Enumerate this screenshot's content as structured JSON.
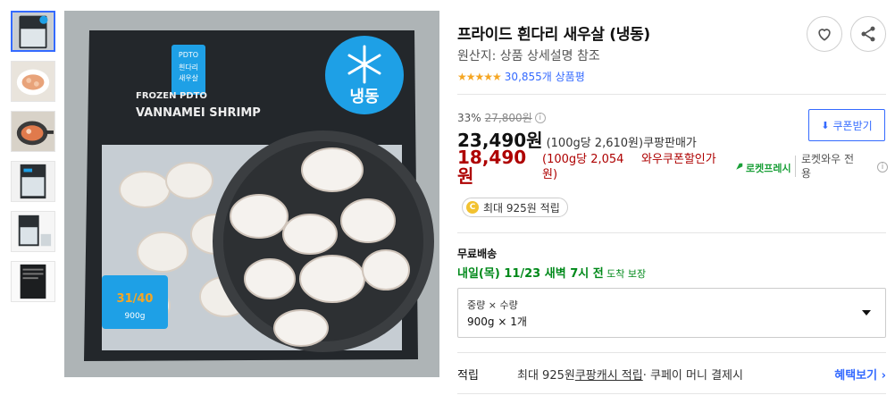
{
  "gallery": {
    "thumbnails": [
      {
        "name": "thumb-package-front",
        "active": true
      },
      {
        "name": "thumb-cooked-dish",
        "active": false
      },
      {
        "name": "thumb-pan-dish",
        "active": false
      },
      {
        "name": "thumb-package-detail",
        "active": false
      },
      {
        "name": "thumb-package-side",
        "active": false
      },
      {
        "name": "thumb-package-back",
        "active": false
      }
    ],
    "main_image": {
      "package_brand": "PDTO",
      "package_korean": "흰다리\n새우살",
      "package_line1": "FROZEN PDTO",
      "package_line2": "VANNAMEI SHRIMP",
      "frozen_badge": "냉동",
      "size_label": "31/40",
      "weight_label": "900g"
    }
  },
  "product": {
    "title": "프라이드 흰다리 새우살 (냉동)",
    "origin": "원산지: 상품 상세설명 참조",
    "stars": "★★★★★",
    "rating": 5,
    "review_count": "30,855개 상품평"
  },
  "pricing": {
    "discount_rate": "33%",
    "original_price": "27,800원",
    "info_mark": "i",
    "sale_price": "23,490원",
    "sale_unit": "(100g당 2,610원)",
    "sale_type": "쿠팡판매가",
    "wow_price": "18,490원",
    "wow_unit": "(100g당 2,054원)",
    "wow_label": "와우쿠폰할인가",
    "rocket_badge": "로켓프레시",
    "rocket_wow": "로켓와우 전용",
    "coupon_button": "쿠폰받기",
    "coupon_icon": "⬇"
  },
  "points": {
    "coin": "C",
    "text": "최대 925원 적립"
  },
  "shipping": {
    "title": "무료배송",
    "date_prefix": "내일(목) 11/23 새벽 7시 전",
    "date_suffix": " 도착 보장"
  },
  "option": {
    "header": "중량 × 수량",
    "value": "900g × 1개"
  },
  "earn": {
    "label": "적립",
    "text_prefix": "최대 925원 ",
    "link": "쿠팡캐시 적립",
    "text_suffix": " · 쿠페이 머니 결제시",
    "benefit": "혜택보기 ›"
  },
  "colors": {
    "accent": "#346aff",
    "wow_red": "#ae0000",
    "rocket_green": "#1ba039",
    "ship_green": "#00891a",
    "star": "#f5a623"
  }
}
